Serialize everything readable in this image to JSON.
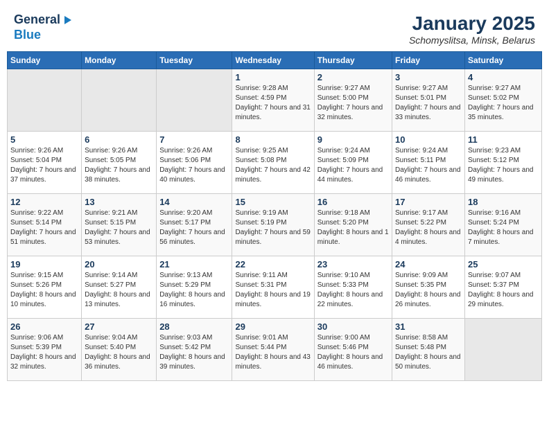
{
  "header": {
    "logo_general": "General",
    "logo_blue": "Blue",
    "title": "January 2025",
    "location": "Schomyslitsa, Minsk, Belarus"
  },
  "calendar": {
    "days_of_week": [
      "Sunday",
      "Monday",
      "Tuesday",
      "Wednesday",
      "Thursday",
      "Friday",
      "Saturday"
    ],
    "weeks": [
      [
        {
          "day": "",
          "empty": true
        },
        {
          "day": "",
          "empty": true
        },
        {
          "day": "",
          "empty": true
        },
        {
          "day": "1",
          "sunrise": "9:28 AM",
          "sunset": "4:59 PM",
          "daylight": "7 hours and 31 minutes."
        },
        {
          "day": "2",
          "sunrise": "9:27 AM",
          "sunset": "5:00 PM",
          "daylight": "7 hours and 32 minutes."
        },
        {
          "day": "3",
          "sunrise": "9:27 AM",
          "sunset": "5:01 PM",
          "daylight": "7 hours and 33 minutes."
        },
        {
          "day": "4",
          "sunrise": "9:27 AM",
          "sunset": "5:02 PM",
          "daylight": "7 hours and 35 minutes."
        }
      ],
      [
        {
          "day": "5",
          "sunrise": "9:26 AM",
          "sunset": "5:04 PM",
          "daylight": "7 hours and 37 minutes."
        },
        {
          "day": "6",
          "sunrise": "9:26 AM",
          "sunset": "5:05 PM",
          "daylight": "7 hours and 38 minutes."
        },
        {
          "day": "7",
          "sunrise": "9:26 AM",
          "sunset": "5:06 PM",
          "daylight": "7 hours and 40 minutes."
        },
        {
          "day": "8",
          "sunrise": "9:25 AM",
          "sunset": "5:08 PM",
          "daylight": "7 hours and 42 minutes."
        },
        {
          "day": "9",
          "sunrise": "9:24 AM",
          "sunset": "5:09 PM",
          "daylight": "7 hours and 44 minutes."
        },
        {
          "day": "10",
          "sunrise": "9:24 AM",
          "sunset": "5:11 PM",
          "daylight": "7 hours and 46 minutes."
        },
        {
          "day": "11",
          "sunrise": "9:23 AM",
          "sunset": "5:12 PM",
          "daylight": "7 hours and 49 minutes."
        }
      ],
      [
        {
          "day": "12",
          "sunrise": "9:22 AM",
          "sunset": "5:14 PM",
          "daylight": "7 hours and 51 minutes."
        },
        {
          "day": "13",
          "sunrise": "9:21 AM",
          "sunset": "5:15 PM",
          "daylight": "7 hours and 53 minutes."
        },
        {
          "day": "14",
          "sunrise": "9:20 AM",
          "sunset": "5:17 PM",
          "daylight": "7 hours and 56 minutes."
        },
        {
          "day": "15",
          "sunrise": "9:19 AM",
          "sunset": "5:19 PM",
          "daylight": "7 hours and 59 minutes."
        },
        {
          "day": "16",
          "sunrise": "9:18 AM",
          "sunset": "5:20 PM",
          "daylight": "8 hours and 1 minute."
        },
        {
          "day": "17",
          "sunrise": "9:17 AM",
          "sunset": "5:22 PM",
          "daylight": "8 hours and 4 minutes."
        },
        {
          "day": "18",
          "sunrise": "9:16 AM",
          "sunset": "5:24 PM",
          "daylight": "8 hours and 7 minutes."
        }
      ],
      [
        {
          "day": "19",
          "sunrise": "9:15 AM",
          "sunset": "5:26 PM",
          "daylight": "8 hours and 10 minutes."
        },
        {
          "day": "20",
          "sunrise": "9:14 AM",
          "sunset": "5:27 PM",
          "daylight": "8 hours and 13 minutes."
        },
        {
          "day": "21",
          "sunrise": "9:13 AM",
          "sunset": "5:29 PM",
          "daylight": "8 hours and 16 minutes."
        },
        {
          "day": "22",
          "sunrise": "9:11 AM",
          "sunset": "5:31 PM",
          "daylight": "8 hours and 19 minutes."
        },
        {
          "day": "23",
          "sunrise": "9:10 AM",
          "sunset": "5:33 PM",
          "daylight": "8 hours and 22 minutes."
        },
        {
          "day": "24",
          "sunrise": "9:09 AM",
          "sunset": "5:35 PM",
          "daylight": "8 hours and 26 minutes."
        },
        {
          "day": "25",
          "sunrise": "9:07 AM",
          "sunset": "5:37 PM",
          "daylight": "8 hours and 29 minutes."
        }
      ],
      [
        {
          "day": "26",
          "sunrise": "9:06 AM",
          "sunset": "5:39 PM",
          "daylight": "8 hours and 32 minutes."
        },
        {
          "day": "27",
          "sunrise": "9:04 AM",
          "sunset": "5:40 PM",
          "daylight": "8 hours and 36 minutes."
        },
        {
          "day": "28",
          "sunrise": "9:03 AM",
          "sunset": "5:42 PM",
          "daylight": "8 hours and 39 minutes."
        },
        {
          "day": "29",
          "sunrise": "9:01 AM",
          "sunset": "5:44 PM",
          "daylight": "8 hours and 43 minutes."
        },
        {
          "day": "30",
          "sunrise": "9:00 AM",
          "sunset": "5:46 PM",
          "daylight": "8 hours and 46 minutes."
        },
        {
          "day": "31",
          "sunrise": "8:58 AM",
          "sunset": "5:48 PM",
          "daylight": "8 hours and 50 minutes."
        },
        {
          "day": "",
          "empty": true
        }
      ]
    ],
    "sunrise_label": "Sunrise:",
    "sunset_label": "Sunset:",
    "daylight_label": "Daylight:"
  }
}
